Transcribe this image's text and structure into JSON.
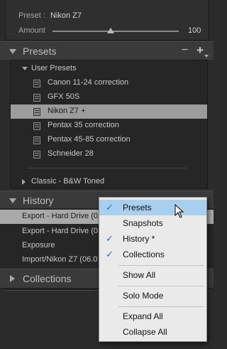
{
  "develop_preset": {
    "preset_label": "Preset :",
    "preset_value": "Nikon Z7",
    "amount_label": "Amount",
    "amount_value": "100",
    "amount_fraction": 0.46
  },
  "presets_panel": {
    "title": "Presets",
    "actions": [
      "−",
      "+"
    ],
    "user_folder": "User Presets",
    "items": [
      {
        "label": "Canon 11-24 correction",
        "selected": false
      },
      {
        "label": "GFX 50S",
        "selected": false
      },
      {
        "label": "Nikon Z7  +",
        "selected": true
      },
      {
        "label": "Pentax 35 correction",
        "selected": false
      },
      {
        "label": "Pentax 45-85 correction",
        "selected": false
      },
      {
        "label": "Schneider 28",
        "selected": false
      }
    ],
    "classic_folder": "Classic - B&W Toned"
  },
  "history_panel": {
    "title": "History",
    "rows": [
      {
        "label": "Export - Hard Drive (0",
        "selected": true
      },
      {
        "label": "Export - Hard Drive (0",
        "selected": false
      },
      {
        "label": "Exposure",
        "selected": false
      },
      {
        "label": "Import/Nikon Z7 (06.0",
        "selected": false
      }
    ]
  },
  "collections_panel": {
    "title": "Collections"
  },
  "context_menu": {
    "items": [
      {
        "label": "Presets",
        "checked": true,
        "highlighted": true
      },
      {
        "label": "Snapshots",
        "checked": false
      },
      {
        "label": "History *",
        "checked": true
      },
      {
        "label": "Collections",
        "checked": true
      },
      {
        "label": "Show All",
        "checked": false
      },
      {
        "label": "Solo Mode",
        "checked": false
      },
      {
        "label": "Expand All",
        "checked": false
      },
      {
        "label": "Collapse All",
        "checked": false
      }
    ],
    "check_glyph": "✓"
  },
  "icons": {
    "collapse": "triangle-down-icon",
    "expand": "triangle-right-icon",
    "preset": "preset-document-icon",
    "cursor": "mouse-pointer-icon"
  },
  "colors": {
    "panel_bg": "#2b2b2b",
    "selected_row": "#9c9c9c",
    "menu_bg": "#eaeaea",
    "menu_highlight": "#a9cfee",
    "check": "#1e6fc8"
  }
}
